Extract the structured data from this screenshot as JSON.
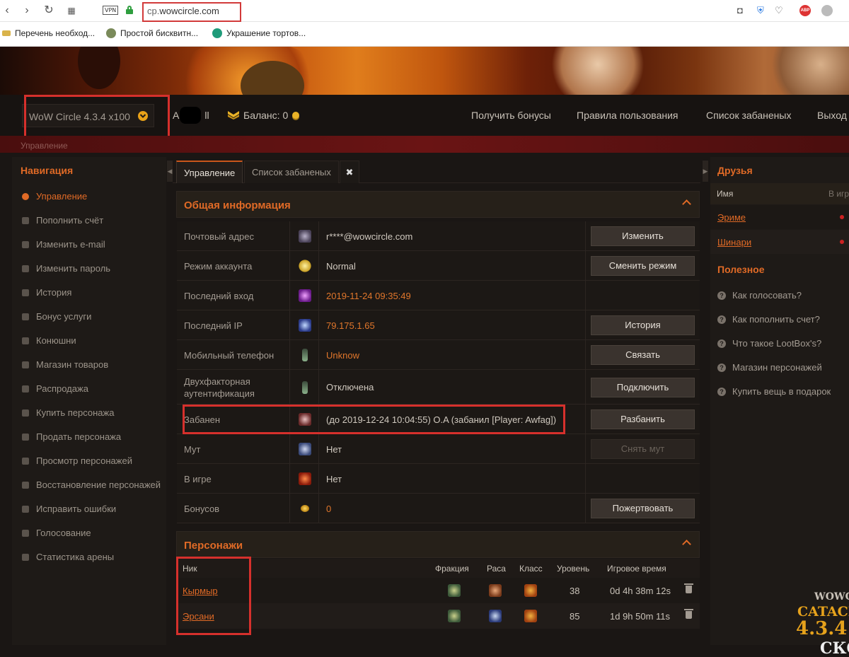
{
  "browser": {
    "url_host": "cp.",
    "url_domain": "wowcircle.com",
    "vpn": "VPN",
    "abp": "ABP",
    "bookmarks": [
      {
        "label": "Перечень необход..."
      },
      {
        "label": "Простой бисквитн..."
      },
      {
        "label": "Украшение тортов..."
      }
    ]
  },
  "header": {
    "server": "WoW Circle 4.3.4 x100",
    "user_initial": "A",
    "user_suffix": "ll",
    "balance_label": "Баланс: 0",
    "links": [
      "Получить бонусы",
      "Правила пользования",
      "Список забаненых",
      "Выход"
    ],
    "breadcrumb": "Управление"
  },
  "sidebar": {
    "title": "Навигация",
    "items": [
      {
        "label": "Управление",
        "active": true
      },
      {
        "label": "Пополнить счёт"
      },
      {
        "label": "Изменить e-mail"
      },
      {
        "label": "Изменить пароль"
      },
      {
        "label": "История"
      },
      {
        "label": "Бонус услуги"
      },
      {
        "label": "Конюшни"
      },
      {
        "label": "Магазин товаров"
      },
      {
        "label": "Распродажа"
      },
      {
        "label": "Купить персонажа"
      },
      {
        "label": "Продать персонажа"
      },
      {
        "label": "Просмотр персонажей"
      },
      {
        "label": "Восстановление персонажей"
      },
      {
        "label": "Исправить ошибки"
      },
      {
        "label": "Голосование"
      },
      {
        "label": "Статистика арены"
      }
    ]
  },
  "tabs": [
    {
      "label": "Управление",
      "active": true
    },
    {
      "label": "Список забаненых"
    }
  ],
  "close_symbol": "✖",
  "info": {
    "title": "Общая информация",
    "rows": [
      {
        "label": "Почтовый адрес",
        "value": "r****@wowcircle.com",
        "button": "Изменить",
        "icon": "mail-icon"
      },
      {
        "label": "Режим аккаунта",
        "value": "Normal",
        "button": "Сменить режим",
        "icon": "star-icon"
      },
      {
        "label": "Последний вход",
        "value": "2019-11-24 09:35:49",
        "button": "",
        "icon": "portal-icon"
      },
      {
        "label": "Последний IP",
        "value": "79.175.1.65",
        "button": "История",
        "icon": "network-icon"
      },
      {
        "label": "Мобильный телефон",
        "value": "Unknow",
        "button": "Связать",
        "icon": "phone-icon"
      },
      {
        "label": "Двухфакторная аутентификация",
        "value": "Отключена",
        "button": "Подключить",
        "icon": "phone-icon"
      },
      {
        "label": "Забанен",
        "value": "(до 2019-12-24 10:04:55) O.A (забанил [Player: Awfag])",
        "button": "Разбанить",
        "icon": "ban-hand-icon"
      },
      {
        "label": "Мут",
        "value": "Нет",
        "button": "Снять мут",
        "icon": "mute-icon"
      },
      {
        "label": "В игре",
        "value": "Нет",
        "button": "",
        "icon": "ingame-icon"
      },
      {
        "label": "Бонусов",
        "value": "0",
        "button": "Пожертвовать",
        "icon": "coin-icon"
      }
    ]
  },
  "characters": {
    "title": "Персонажи",
    "headers": [
      "Ник",
      "Фракция",
      "Раса",
      "Класс",
      "Уровень",
      "Игровое время"
    ],
    "rows": [
      {
        "name": "Кырмыр",
        "level": "38",
        "time": "0d 4h 38m 12s"
      },
      {
        "name": "Эрсани",
        "level": "85",
        "time": "1d 9h 50m 11s"
      }
    ]
  },
  "friends": {
    "title": "Друзья",
    "headers": [
      "Имя",
      "В игре"
    ],
    "rows": [
      {
        "name": "Эриме"
      },
      {
        "name": "Шинари"
      }
    ]
  },
  "useful": {
    "title": "Полезное",
    "items": [
      "Как голосовать?",
      "Как пополнить счет?",
      "Что такое LootBox's?",
      "Магазин персонажей",
      "Купить вещь в подарок"
    ]
  },
  "logo": {
    "l1": "WOWC",
    "l2": "CATACL",
    "l3": "4.3.4",
    "l4": "СКО"
  },
  "colors": {
    "accent": "#e06a26",
    "highlight": "#d6302c",
    "coin": "#e9b227"
  }
}
